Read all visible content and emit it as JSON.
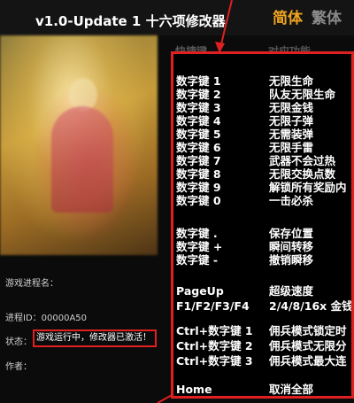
{
  "window": {
    "title": "v1.0-Update 1 十六项修改器",
    "lang_tabs": [
      {
        "label": "简体",
        "active": true
      },
      {
        "label": "繁体",
        "active": false
      }
    ]
  },
  "info": {
    "process_label": "游戏进程名：",
    "process_id_label": "进程ID：",
    "process_id_value": "00000A50",
    "status_label": "状态：",
    "status_value": "游戏运行中，修改器已激活！",
    "author_label": "作者："
  },
  "panel": {
    "header_key": "快捷键",
    "header_func": "对应功能",
    "hotkeys": [
      {
        "key": "数字键 1",
        "func": "无限生命"
      },
      {
        "key": "数字键 2",
        "func": "队友无限生命"
      },
      {
        "key": "数字键 3",
        "func": "无限金钱"
      },
      {
        "key": "数字键 4",
        "func": "无限子弹"
      },
      {
        "key": "数字键 5",
        "func": "无需装弹"
      },
      {
        "key": "数字键 6",
        "func": "无限手雷"
      },
      {
        "key": "数字键 7",
        "func": "武器不会过热"
      },
      {
        "key": "数字键 8",
        "func": "无限交换点数"
      },
      {
        "key": "数字键 9",
        "func": "解锁所有奖励内"
      },
      {
        "key": "数字键 0",
        "func": "一击必杀"
      },
      {
        "key": "数字键 .",
        "func": "保存位置"
      },
      {
        "key": "数字键 +",
        "func": "瞬间转移"
      },
      {
        "key": "数字键 -",
        "func": "撤销瞬移"
      },
      {
        "key": "PageUp",
        "func": "超级速度"
      },
      {
        "key": "F1/F2/F3/F4",
        "func": "2/4/8/16x 金钱"
      },
      {
        "key": "Ctrl+数字键 1",
        "func": "佣兵模式锁定时"
      },
      {
        "key": "Ctrl+数字键 2",
        "func": "佣兵模式无限分"
      },
      {
        "key": "Ctrl+数字键 3",
        "func": "佣兵模式最大连"
      },
      {
        "key": "Home",
        "func": "取消全部"
      }
    ]
  },
  "colors": {
    "accent": "#f0a520",
    "highlight": "#e02020",
    "background": "#0b0b0b"
  }
}
